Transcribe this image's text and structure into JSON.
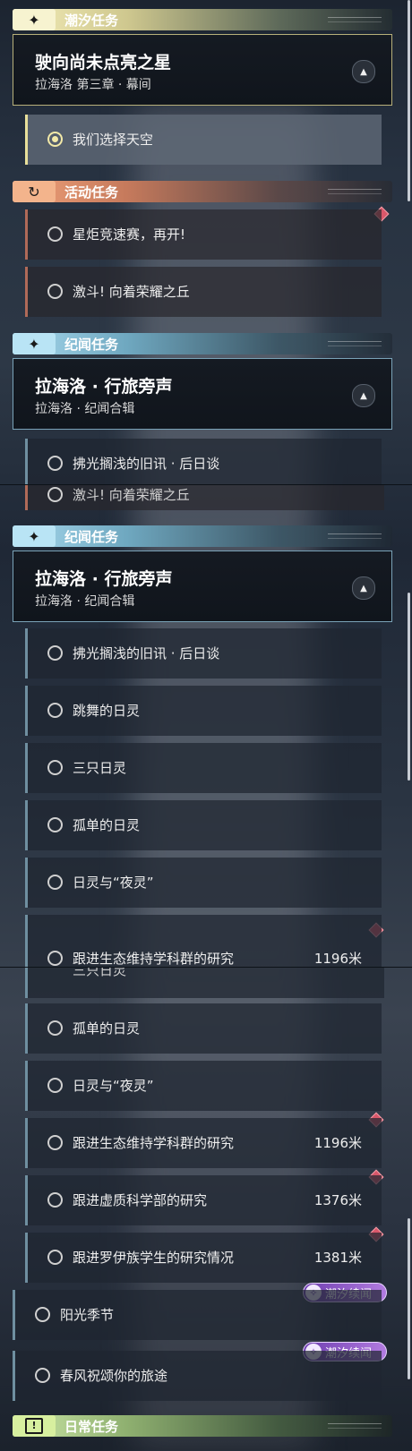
{
  "segment1": {
    "cat_tide": {
      "icon": "✦",
      "label": "潮汐任务"
    },
    "hero": {
      "title": "驶向尚未点亮之星",
      "subtitle": "拉海洛 第三章 · 幕间",
      "toggle_icon": "▲"
    },
    "selected_row": {
      "label": "我们选择天空"
    },
    "cat_activity": {
      "icon": "↻",
      "label": "活动任务"
    },
    "activity_rows": [
      {
        "label": "星炬竞速赛，再开!"
      },
      {
        "label": "激斗! 向着荣耀之丘"
      }
    ],
    "cat_lore": {
      "icon": "✦",
      "label": "纪闻任务"
    },
    "lore_hero": {
      "title": "拉海洛 · 行旅旁声",
      "subtitle": "拉海洛 · 纪闻合辑",
      "toggle_icon": "▲"
    },
    "cut_row": {
      "label": "拂光搁浅的旧讯 · 后日谈"
    }
  },
  "segment2": {
    "cut_row_top": {
      "label": "激斗! 向着荣耀之丘"
    },
    "cat_lore": {
      "icon": "✦",
      "label": "纪闻任务"
    },
    "lore_hero": {
      "title": "拉海洛 · 行旅旁声",
      "subtitle": "拉海洛 · 纪闻合辑",
      "toggle_icon": "▲"
    },
    "rows": [
      {
        "label": "拂光搁浅的旧讯 · 后日谈"
      },
      {
        "label": "跳舞的日灵"
      },
      {
        "label": "三只日灵"
      },
      {
        "label": "孤单的日灵"
      },
      {
        "label": "日灵与“夜灵”"
      }
    ],
    "cut_row": {
      "label": "跟进生态维持学科群的研究",
      "dist": "1196米"
    }
  },
  "segment3": {
    "cut_row_top": {
      "label": "三只日灵"
    },
    "rows": [
      {
        "label": "孤单的日灵",
        "dist": ""
      },
      {
        "label": "日灵与“夜灵”",
        "dist": ""
      },
      {
        "label": "跟进生态维持学科群的研究",
        "dist": "1196米"
      },
      {
        "label": "跟进虚质科学部的研究",
        "dist": "1376米"
      },
      {
        "label": "跟进罗伊族学生的研究情况",
        "dist": "1381米"
      },
      {
        "label": "阳光季节",
        "dist": ""
      },
      {
        "label": "春风祝颂你的旅途",
        "dist": ""
      }
    ],
    "tags": [
      {
        "label": "潮汐续闻",
        "icon": "✧"
      },
      {
        "label": "潮汐续闻",
        "icon": "✧"
      }
    ],
    "cat_daily": {
      "icon": "!",
      "label": "日常任务"
    }
  },
  "colors": {
    "tide": "#f3ecb8",
    "activity": "#f0a27a",
    "lore": "#a8d9ee",
    "daily": "#cde8a8",
    "marker": "#d9576a",
    "tag": "#8b55c8"
  }
}
